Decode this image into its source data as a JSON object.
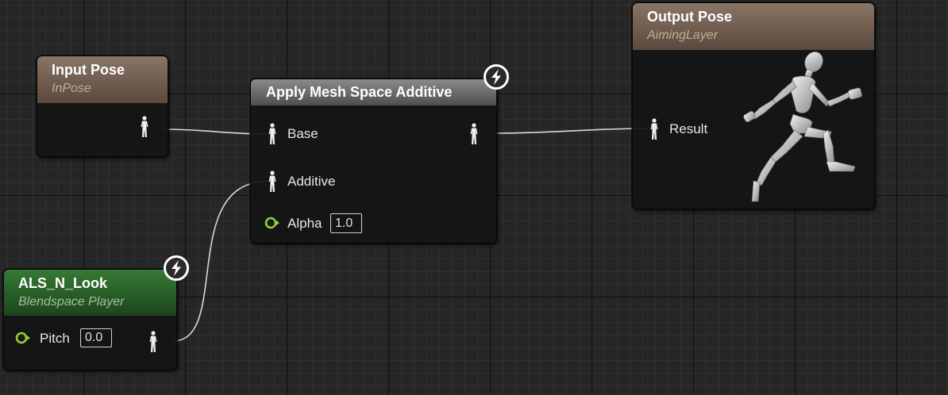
{
  "nodes": {
    "input_pose": {
      "title": "Input Pose",
      "subtitle": "InPose"
    },
    "apply_additive": {
      "title": "Apply Mesh Space Additive",
      "pins": {
        "base": "Base",
        "additive": "Additive",
        "alpha": "Alpha"
      },
      "alpha_value": "1.0"
    },
    "output_pose": {
      "title": "Output Pose",
      "subtitle": "AimingLayer",
      "pins": {
        "result": "Result"
      }
    },
    "blendspace": {
      "title": "ALS_N_Look",
      "subtitle": "Blendspace Player",
      "pins": {
        "pitch": "Pitch"
      },
      "pitch_value": "0.0"
    }
  },
  "colors": {
    "canvas_bg": "#262626",
    "pose_header": "#6e5a4e",
    "function_header": "#6a6a6a",
    "blendspace_header": "#2a5f2a",
    "float_pin": "#8fd13a",
    "wire": "#dcdcdc"
  },
  "icons": {
    "pose_pin": "pose-pin-figure-icon",
    "float_pin": "float-pin-icon",
    "fast_path": "lightning-bolt-icon",
    "preview": "running-mannequin"
  }
}
